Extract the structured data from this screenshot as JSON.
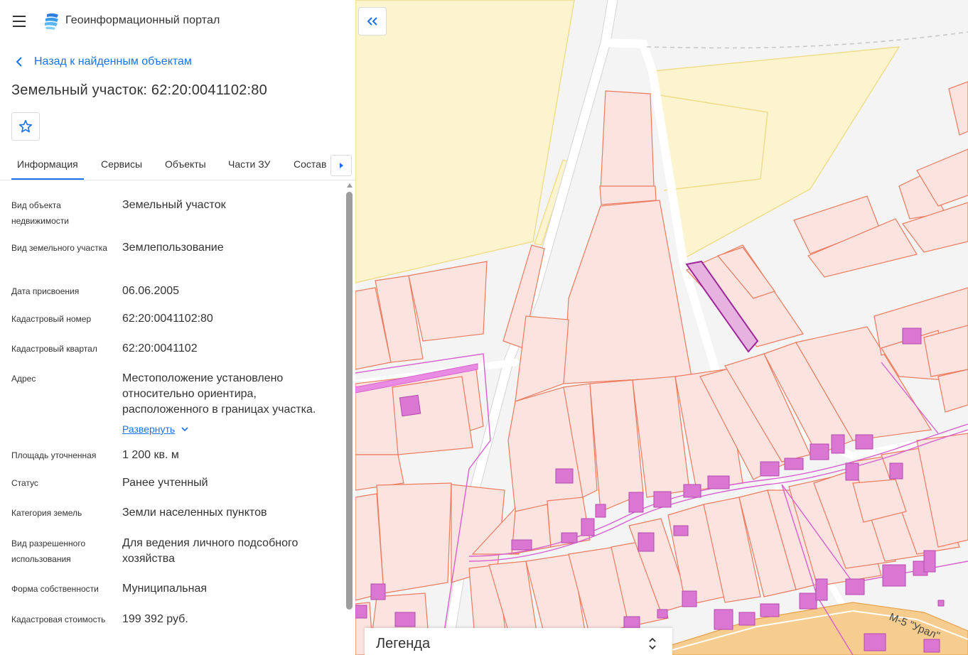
{
  "app": {
    "title": "Геоинформационный портал",
    "menu_icon": "hamburger-menu-icon",
    "logo_icon": "portal-logo-icon",
    "accent_color": "#1a73e8"
  },
  "nav": {
    "back_label": "Назад к найденным объектам",
    "back_icon": "chevron-left-icon"
  },
  "object": {
    "title": "Земельный участок: 62:20:0041102:80",
    "favorite_icon": "star-outline-icon"
  },
  "tabs": [
    {
      "label": "Информация",
      "active": true
    },
    {
      "label": "Сервисы",
      "active": false
    },
    {
      "label": "Объекты",
      "active": false
    },
    {
      "label": "Части ЗУ",
      "active": false
    },
    {
      "label": "Состав",
      "active": false
    }
  ],
  "tabs_scroll_icon": "caret-right-icon",
  "fields": [
    {
      "label": "Вид объекта недвижимости",
      "value": "Земельный участок"
    },
    {
      "label": "Вид земельного участка",
      "value": "Землепользование"
    },
    {
      "label": "Дата присвоения",
      "value": "06.06.2005"
    },
    {
      "label": "Кадастровый номер",
      "value": "62:20:0041102:80"
    },
    {
      "label": "Кадастровый квартал",
      "value": "62:20:0041102"
    },
    {
      "label": "Адрес",
      "value": "Местоположение установлено относительно ориентира, расположенного в границах участка.",
      "expand_label": "Развернуть"
    },
    {
      "label": "Площадь уточненная",
      "value": "1 200 кв. м"
    },
    {
      "label": "Статус",
      "value": "Ранее учтенный"
    },
    {
      "label": "Категория земель",
      "value": "Земли населенных пунктов"
    },
    {
      "label": "Вид разрешенного использования",
      "value": "Для ведения личного подсобного хозяйства"
    },
    {
      "label": "Форма собственности",
      "value": "Муниципальная"
    },
    {
      "label": "Кадастровая стоимость",
      "value": "199 392 руб."
    }
  ],
  "map": {
    "collapse_icon": "double-chevron-left-icon",
    "legend_label": "Легенда",
    "legend_toggle_icon": "chevron-up-down-icon",
    "road_label": "М-5 \"Урал\"",
    "colors": {
      "background": "#f5f4f4",
      "parcel_fill": "#fbe3df",
      "parcel_stroke": "#ec7b5e",
      "forest_fill": "#fbf4cf",
      "forest_stroke": "#efdc86",
      "building_fill": "#d977d3",
      "selected_fill": "#e6b3e0",
      "selected_stroke": "#a0279a",
      "highway_fill": "#f6cd8e",
      "pink_line": "#d85fd0"
    }
  }
}
